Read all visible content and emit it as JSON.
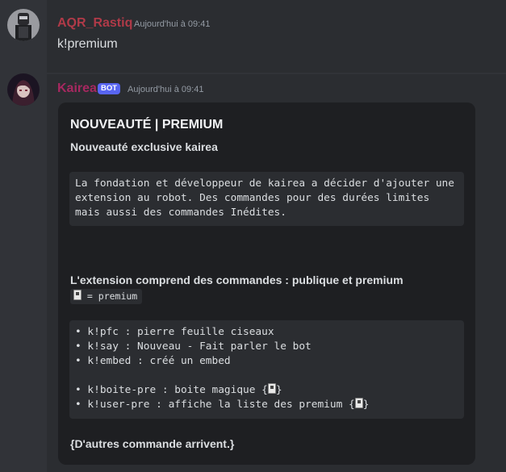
{
  "messages": [
    {
      "username": "AQR_Rastiq",
      "username_color": "#b03a48",
      "timestamp": "Aujourd'hui à 09:41",
      "content": "k!premium"
    },
    {
      "username": "Kairea",
      "username_color": "#a72860",
      "bot_tag": "BOT",
      "timestamp": "Aujourd'hui à 09:41",
      "embed": {
        "title": "NOUVEAUTÉ | PREMIUM",
        "subtitle": "Nouveauté exclusive kairea",
        "intro_code": [
          "La fondation et développeur de kairea a décider d'ajouter une",
          "extension au robot. Des commandes pour des durées limites",
          "mais aussi des commandes Inédites."
        ],
        "section_heading": "L'extension comprend des commandes : publique et premium",
        "legend_icon": "premium-icon",
        "legend_text": " = premium",
        "commands": [
          "• k!pfc : pierre feuille ciseaux",
          "• k!say : Nouveau - Fait parler le bot",
          "• k!embed : créé un embed",
          "",
          "• k!boite-pre : boite magique {",
          "• k!user-pre : affiche la liste des premium {"
        ],
        "command_suffix": "}",
        "footer": "{D'autres commande arrivent.}"
      }
    }
  ],
  "colors": {
    "background": "#313338",
    "embed_background": "#1e1f22",
    "code_background": "#2b2d31",
    "bot_tag": "#5865f2"
  }
}
